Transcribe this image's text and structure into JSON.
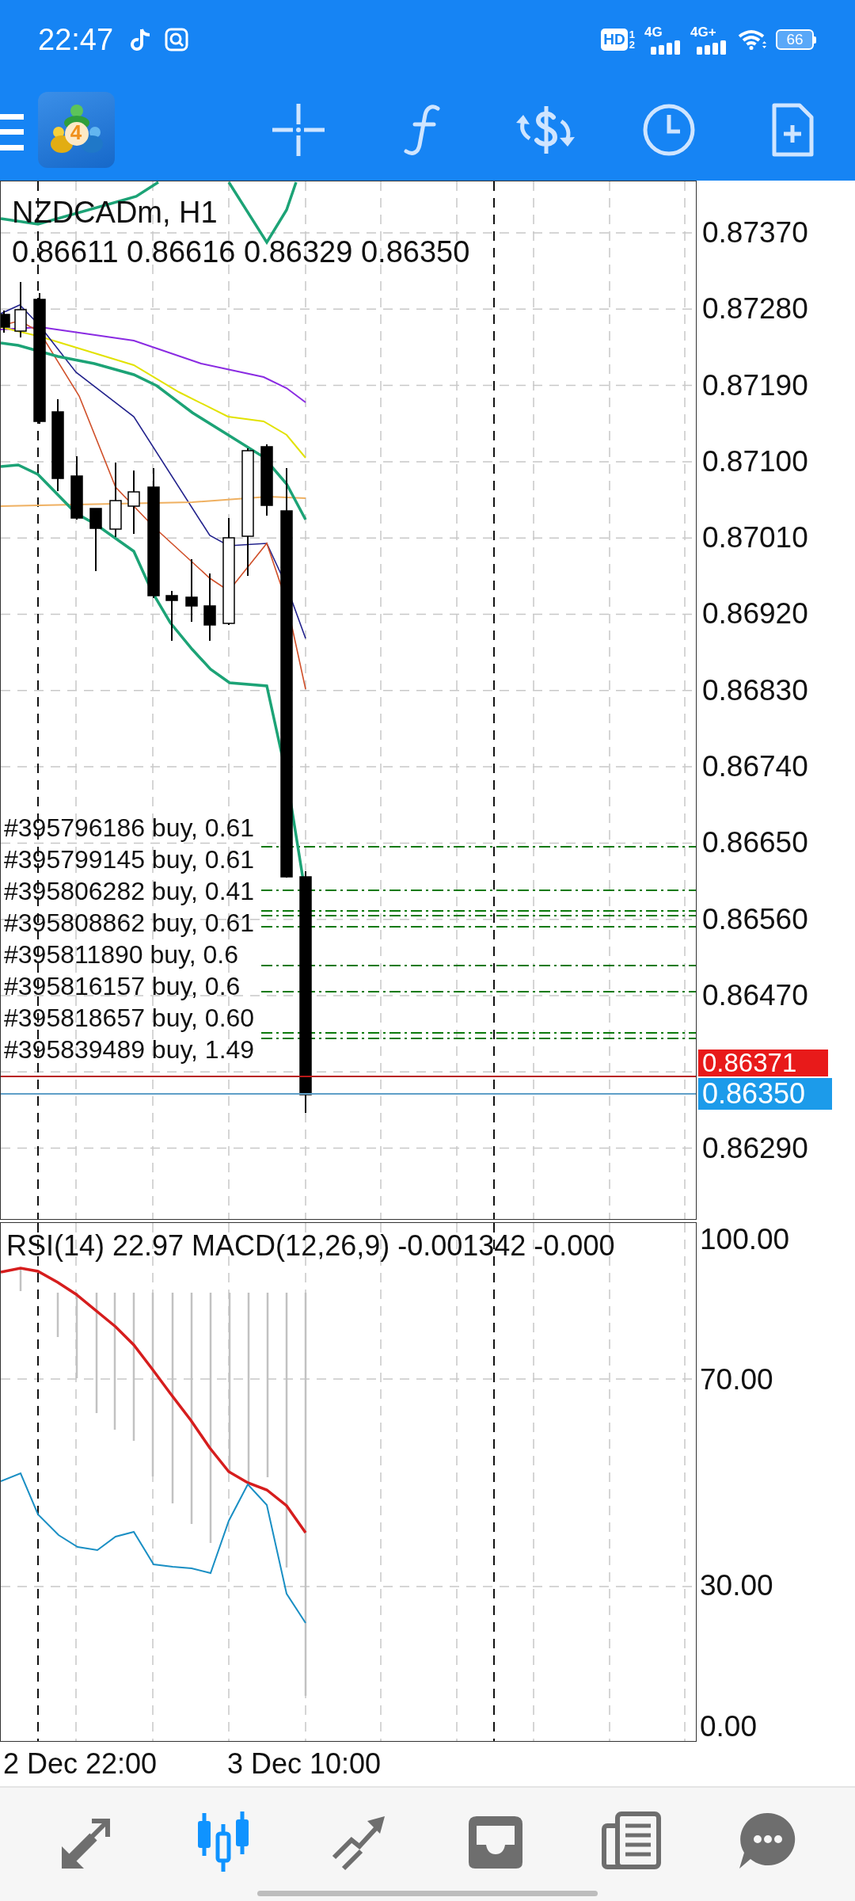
{
  "status_bar": {
    "time": "22:47",
    "hd": "HD",
    "hd_slots": [
      "1",
      "2"
    ],
    "networks": [
      "4G",
      "4G+"
    ],
    "battery": "66"
  },
  "toolbar": {
    "logo_digit": "4"
  },
  "chart": {
    "symbol": "NZDCADm, H1",
    "ohlc": "0.86611 0.86616 0.86329 0.86350",
    "orders": [
      {
        "label": "#395796186 buy, 0.61"
      },
      {
        "label": "#395799145 buy, 0.61"
      },
      {
        "label": "#395806282 buy, 0.41"
      },
      {
        "label": "#395808862 buy, 0.61"
      },
      {
        "label": "#395811890 buy, 0.6"
      },
      {
        "label": "#395816157 buy, 0.6"
      },
      {
        "label": "#395818657 buy, 0.60"
      },
      {
        "label": "#395839489 buy, 1.49"
      }
    ],
    "price_axis": {
      "upper": [
        "0.87370",
        "0.87280",
        "0.87190",
        "0.87100",
        "0.87010",
        "0.86920",
        "0.86830",
        "0.86740",
        "0.86650",
        "0.86560",
        "0.86470"
      ],
      "ask": "0.86371",
      "bid": "0.86350",
      "lower": [
        "0.86290"
      ]
    }
  },
  "indicator": {
    "legend": "RSI(14) 22.97 MACD(12,26,9) -0.001342 -0.000",
    "axis": [
      "100.00",
      "70.00",
      "30.00",
      "0.00"
    ]
  },
  "time_axis": [
    "2 Dec 22:00",
    "3 Dec 10:00"
  ],
  "bottom_nav": [
    {
      "kind": "arrows",
      "selected": false
    },
    {
      "kind": "candles",
      "selected": true
    },
    {
      "kind": "trend",
      "selected": false
    },
    {
      "kind": "tray",
      "selected": false
    },
    {
      "kind": "newspaper",
      "selected": false
    },
    {
      "kind": "chat",
      "selected": false
    }
  ]
}
